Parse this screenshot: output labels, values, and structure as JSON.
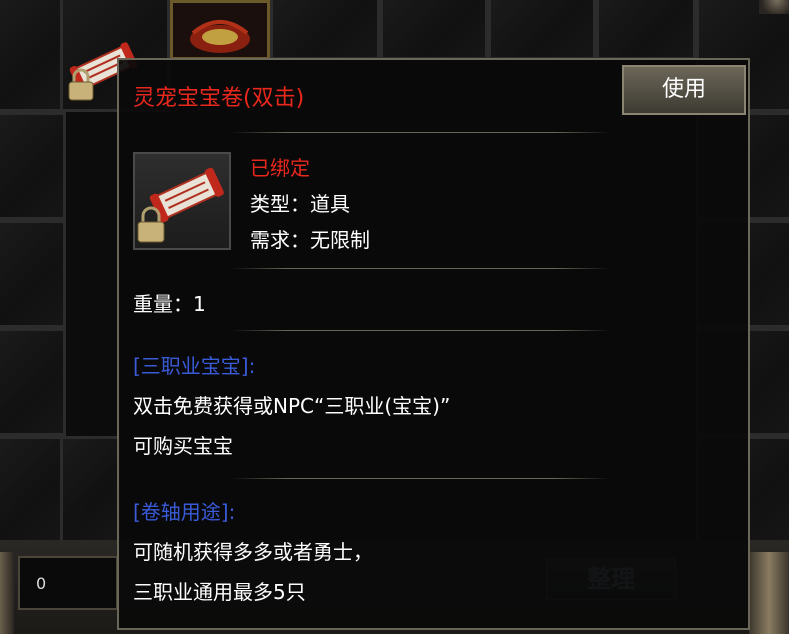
{
  "tooltip": {
    "title": "灵宠宝宝卷(双击)",
    "use_button": "使用",
    "bound_status": "已绑定",
    "type_line": "类型：道具",
    "require_line": "需求：无限制",
    "weight_line": "重量：1",
    "section1_header": "[三职业宝宝]:",
    "section1_line1": "双击免费获得或NPC“三职业(宝宝)”",
    "section1_line2": "可购买宝宝",
    "section2_header": "[卷轴用途]:",
    "section2_line1": "可随机获得多多或者勇士，",
    "section2_line2": "三职业通用最多5只"
  },
  "inventory": {
    "gold_value": "0",
    "sort_button": "整理"
  },
  "icons": {
    "item": "scroll-icon",
    "lock": "lock-icon",
    "equipped_slot": "ornament-icon"
  },
  "colors": {
    "title_red": "#e8271d",
    "section_blue": "#3a5bd9",
    "border": "#6b6758"
  }
}
